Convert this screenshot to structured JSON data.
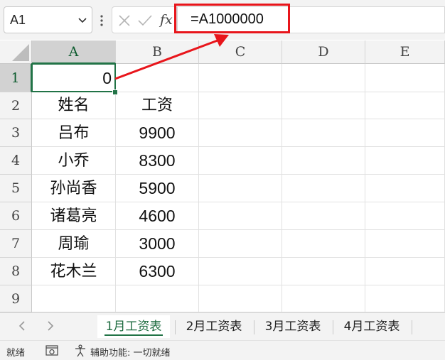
{
  "name_box": {
    "value": "A1"
  },
  "formula_bar": {
    "fx_label": "fx",
    "formula": "=A1000000"
  },
  "columns": [
    "A",
    "B",
    "C",
    "D",
    "E"
  ],
  "rows": [
    "1",
    "2",
    "3",
    "4",
    "5",
    "6",
    "7",
    "8",
    "9"
  ],
  "cells": {
    "A1": "0",
    "A2": "姓名",
    "B2": "工资",
    "A3": "吕布",
    "B3": "9900",
    "A4": "小乔",
    "B4": "8300",
    "A5": "孙尚香",
    "B5": "5900",
    "A6": "诸葛亮",
    "B6": "4600",
    "A7": "周瑜",
    "B7": "3000",
    "A8": "花木兰",
    "B8": "6300"
  },
  "sheet_tabs": [
    {
      "label": "1月工资表",
      "active": true
    },
    {
      "label": "2月工资表",
      "active": false
    },
    {
      "label": "3月工资表",
      "active": false
    },
    {
      "label": "4月工资表",
      "active": false
    }
  ],
  "status_bar": {
    "ready": "就绪",
    "accessibility": "辅助功能: 一切就绪"
  },
  "colors": {
    "accent_green": "#217346",
    "annotation_red": "#e8151b"
  }
}
